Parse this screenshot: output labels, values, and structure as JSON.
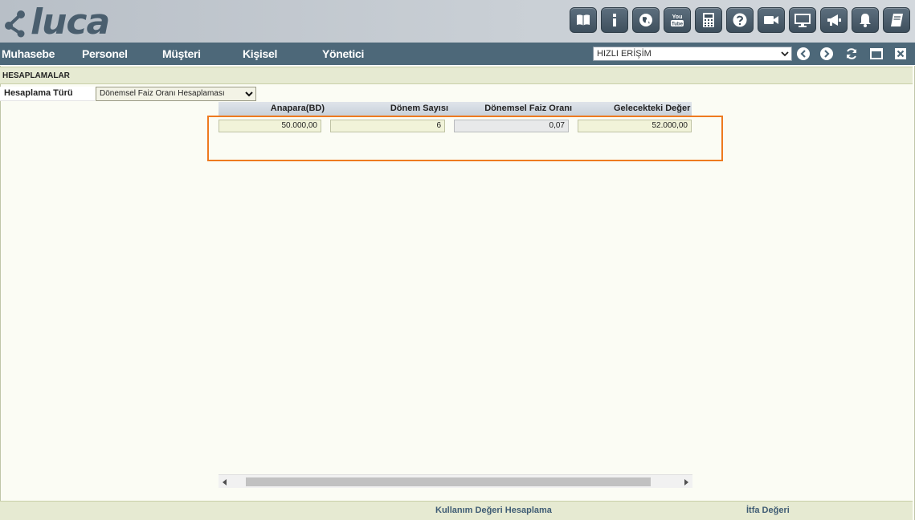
{
  "app": {
    "logo_text": "luca"
  },
  "toolbar": {
    "icons": [
      "book-icon",
      "info-icon",
      "globe-icon",
      "youtube-icon",
      "calculator-icon",
      "help-icon",
      "video-icon",
      "monitor-icon",
      "megaphone-icon",
      "bell-icon",
      "notebook-icon"
    ],
    "youtube_text_top": "You",
    "youtube_text_bottom": "Tube"
  },
  "nav": {
    "items": [
      "Muhasebe",
      "Personel",
      "Müşteri",
      "Kişisel",
      "Yönetici"
    ],
    "quick_access": "HIZLI ERİŞİM"
  },
  "section": {
    "title": "HESAPLAMALAR"
  },
  "form": {
    "calc_type_label": "Hesaplama Türü",
    "calc_type_value": "Dönemsel Faiz Oranı Hesaplaması"
  },
  "grid": {
    "headers": [
      "Anapara(BD)",
      "Dönem Sayısı",
      "Dönemsel Faiz Oranı",
      "Gelecekteki Değer"
    ],
    "values": [
      "50.000,00",
      "6",
      "0,07",
      "52.000,00"
    ]
  },
  "footer": {
    "link1": "Kullanım Değeri Hesaplama",
    "link2": "İtfa Değeri"
  },
  "colors": {
    "nav_bg": "#4d6879",
    "accent_highlight": "#ee7a1f",
    "footer_link": "#3f5c74"
  }
}
